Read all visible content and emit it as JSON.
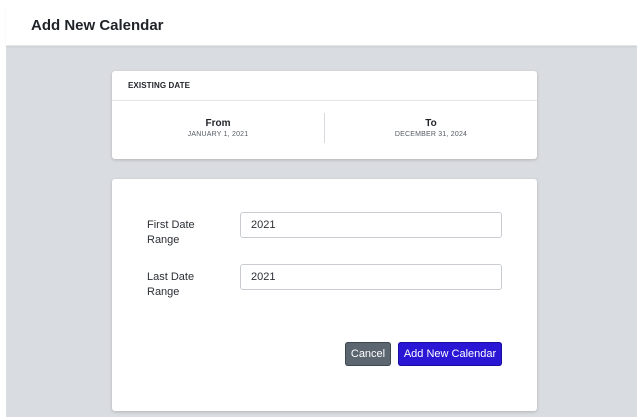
{
  "page": {
    "title": "Add New Calendar"
  },
  "existing": {
    "header": "EXISTING DATE",
    "from_label": "From",
    "from_value": "JANUARY 1, 2021",
    "to_label": "To",
    "to_value": "DECEMBER 31, 2024"
  },
  "form": {
    "first_label": "First Date Range",
    "first_value": "2021",
    "last_label": "Last Date Range",
    "last_value": "2021",
    "cancel_label": "Cancel",
    "submit_label": "Add New Calendar"
  },
  "colors": {
    "primary_button": "#2a17d6",
    "secondary_button": "#5c6670",
    "background": "#d9dce0"
  }
}
